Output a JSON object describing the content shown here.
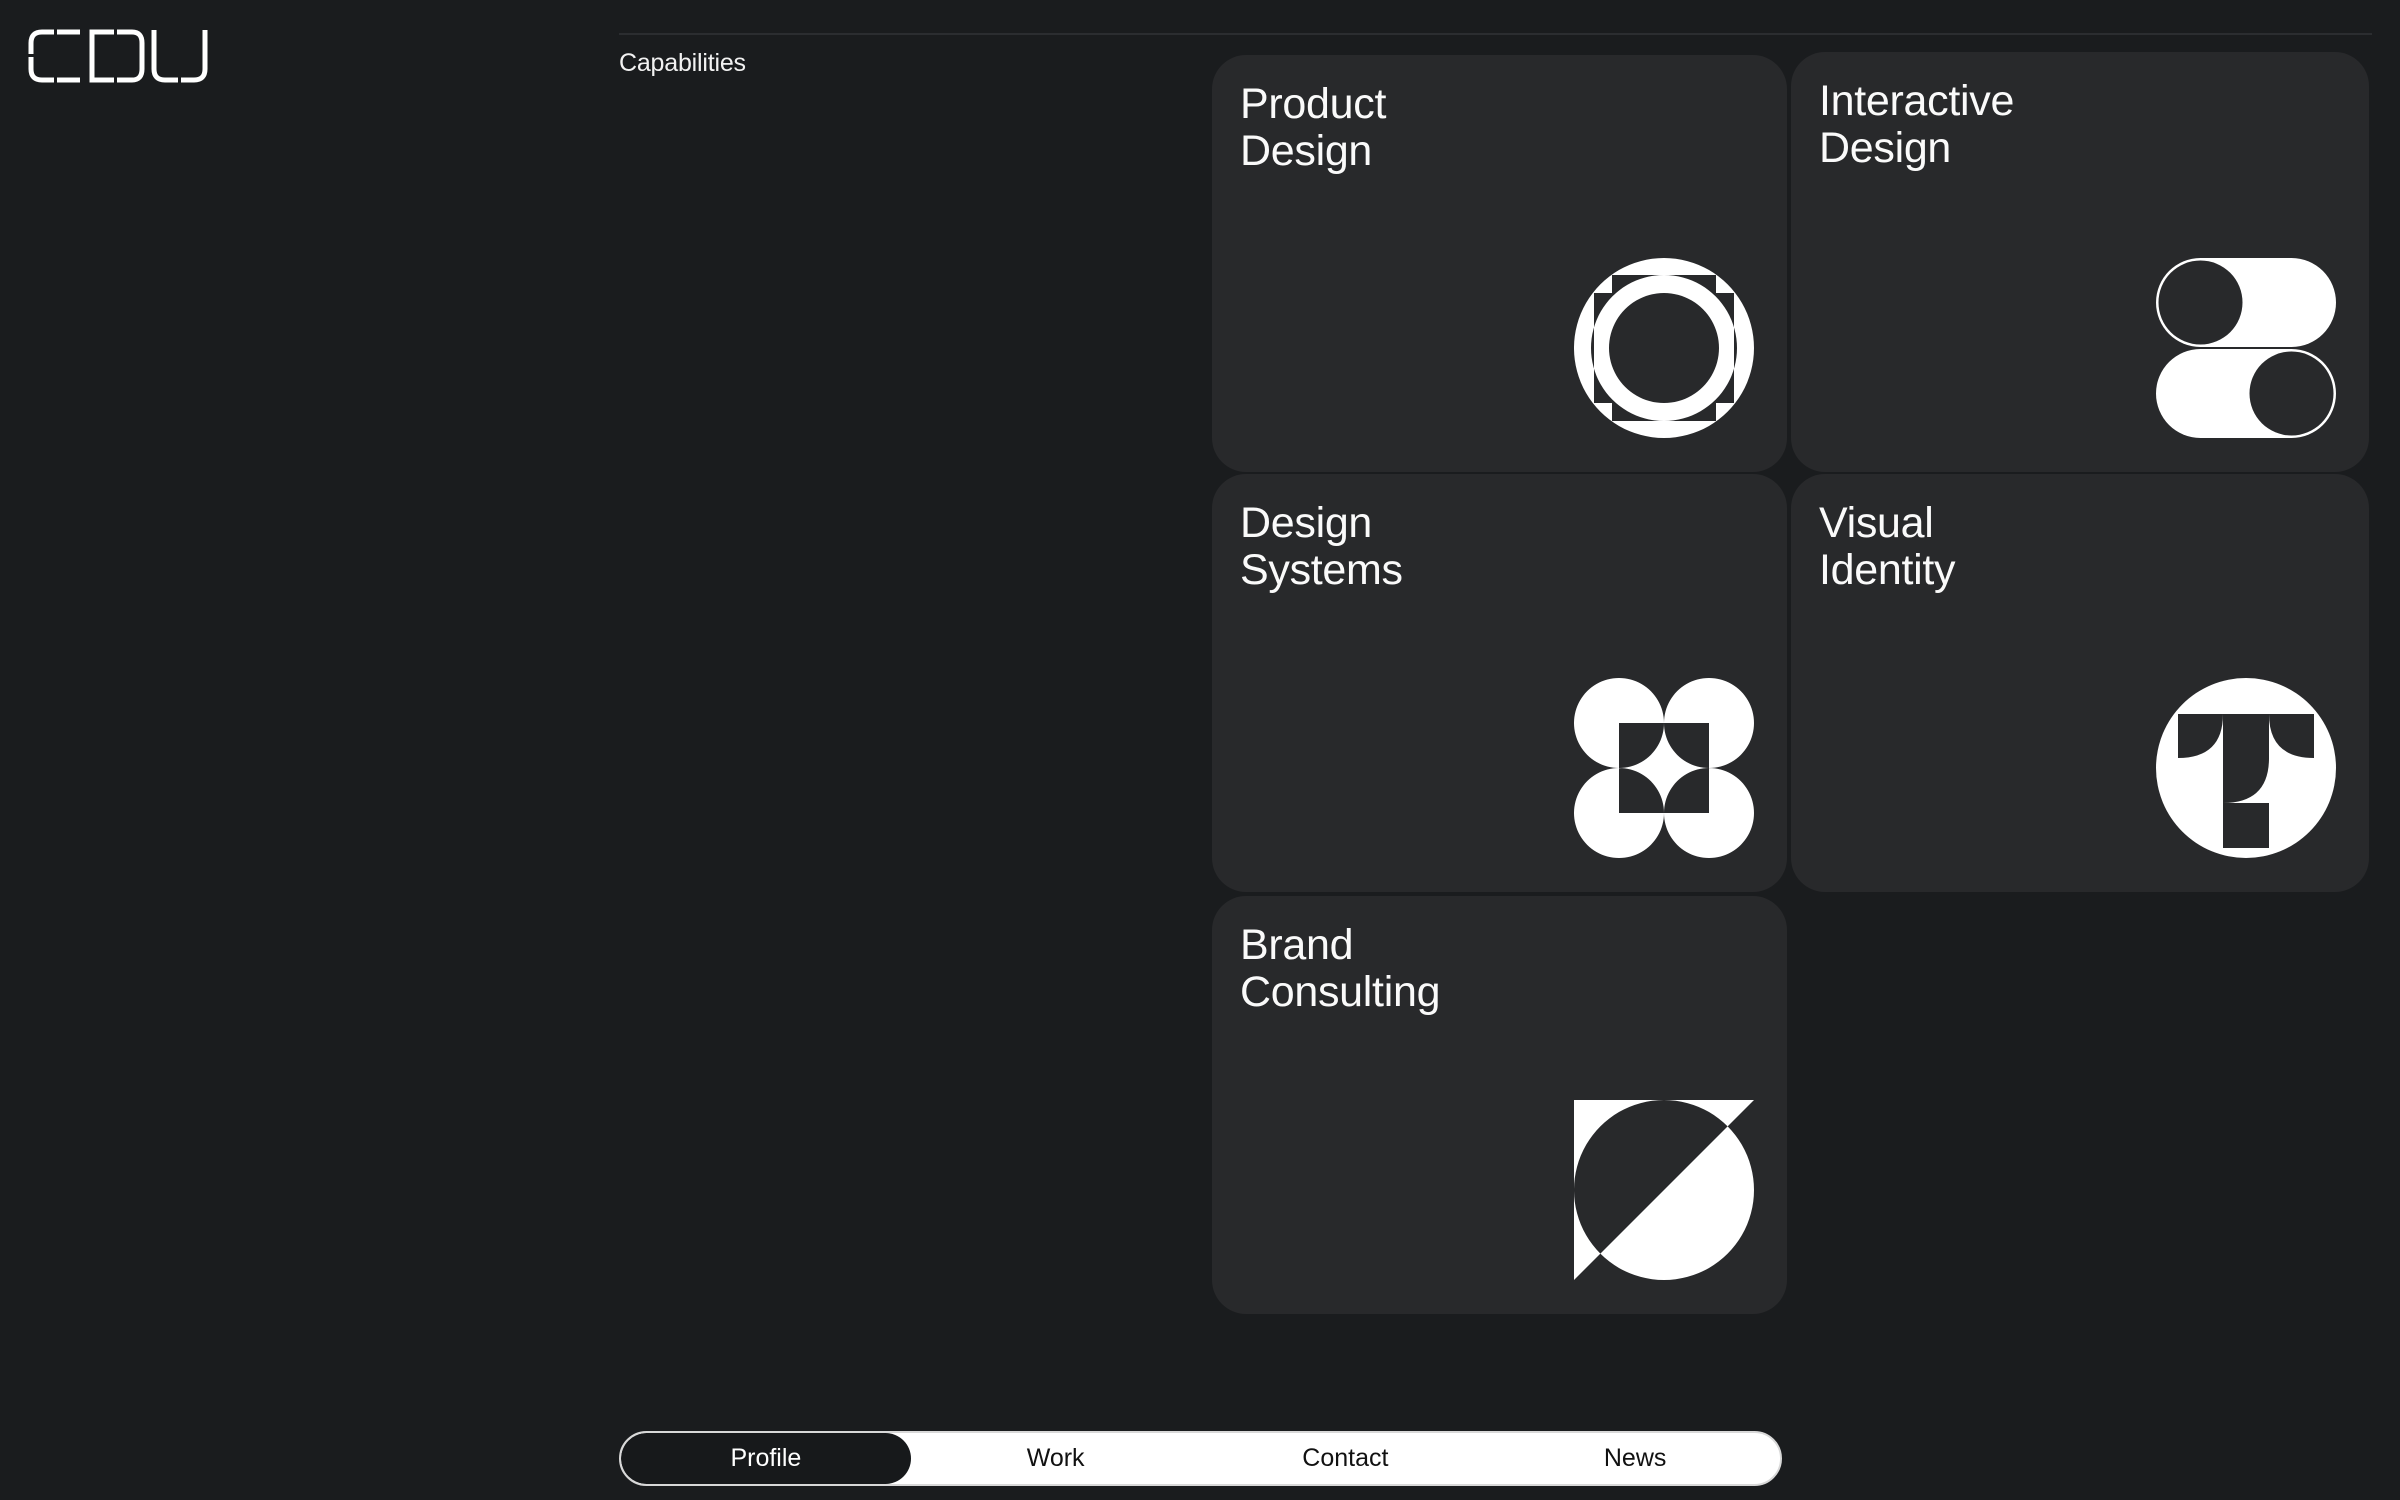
{
  "brand": {
    "logo_text": "CDU"
  },
  "section": {
    "label": "Capabilities"
  },
  "cards": [
    {
      "title": "Product\nDesign",
      "icon": "concentric-squares-circle-icon"
    },
    {
      "title": "Interactive\nDesign",
      "icon": "toggle-switches-icon"
    },
    {
      "title": "Design\nSystems",
      "icon": "four-circles-grid-icon"
    },
    {
      "title": "Visual\nIdentity",
      "icon": "letter-t-circle-icon"
    },
    {
      "title": "Brand\nConsulting",
      "icon": "split-circle-triangle-icon"
    }
  ],
  "nav": {
    "items": [
      {
        "label": "Profile",
        "active": true
      },
      {
        "label": "Work",
        "active": false
      },
      {
        "label": "Contact",
        "active": false
      },
      {
        "label": "News",
        "active": false
      }
    ]
  },
  "colors": {
    "background": "#1a1c1e",
    "card": "#28292b",
    "foreground": "#ffffff",
    "nav_active": "#17191b"
  }
}
